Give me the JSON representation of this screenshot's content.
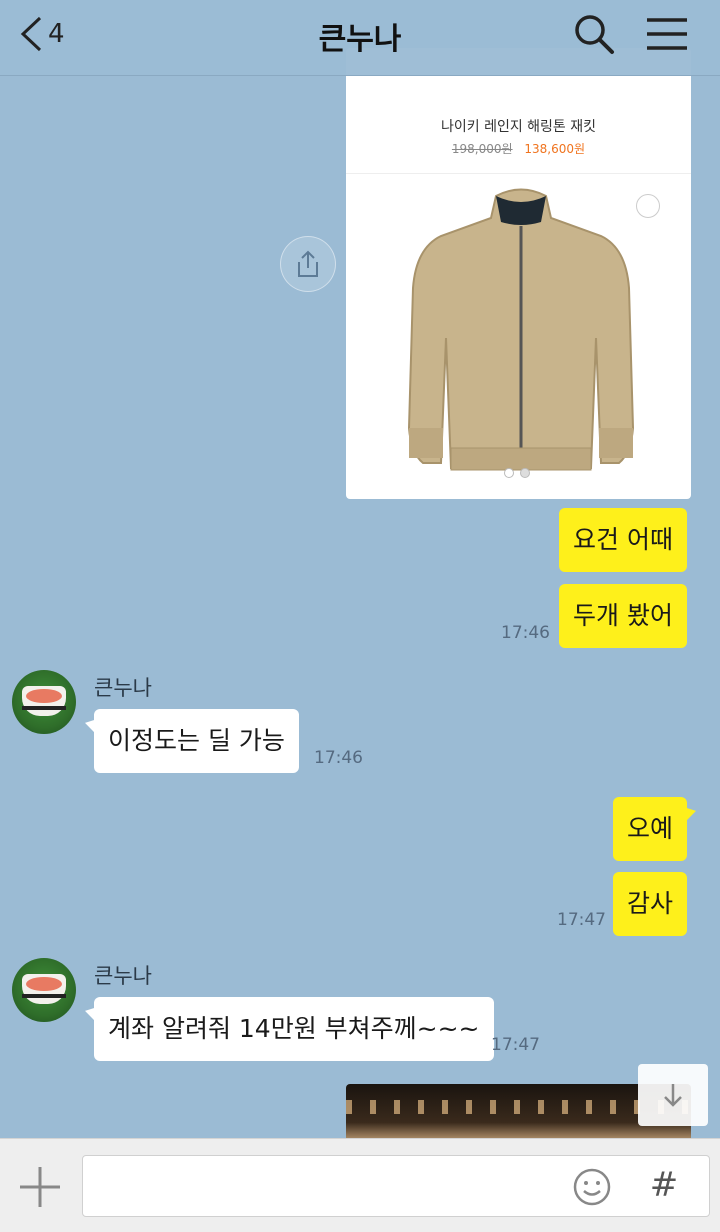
{
  "header": {
    "back_count": "4",
    "title": "큰누나"
  },
  "product_card": {
    "name": "나이키 레인지 해링톤 재킷",
    "original_price": "198,000원",
    "sale_price": "138,600원",
    "slide_count": 2,
    "active_slide": 1
  },
  "messages": {
    "m1": "요건 어때",
    "m2": "두개 봤어",
    "m2_time": "17:46",
    "sender_name_1": "큰누나",
    "m3": "이정도는 딜 가능",
    "m3_time": "17:46",
    "m4": "오예",
    "m5": "감사",
    "m5_time": "17:47",
    "sender_name_2": "큰누나",
    "m6": "계좌 알려줘 14만원 부쳐주께~~~",
    "m6_time": "17:47"
  },
  "input": {
    "value": "",
    "hash_label": "#"
  },
  "icons": {
    "back": "chevron-left-icon",
    "search": "search-icon",
    "menu": "hamburger-menu-icon",
    "share": "share-icon",
    "scroll_down": "arrow-down-icon",
    "plus": "plus-icon",
    "emoji": "smiley-icon"
  },
  "colors": {
    "background": "#9bbbd4",
    "my_bubble": "#fef01b",
    "their_bubble": "#ffffff",
    "sale_price": "#f0741f"
  }
}
